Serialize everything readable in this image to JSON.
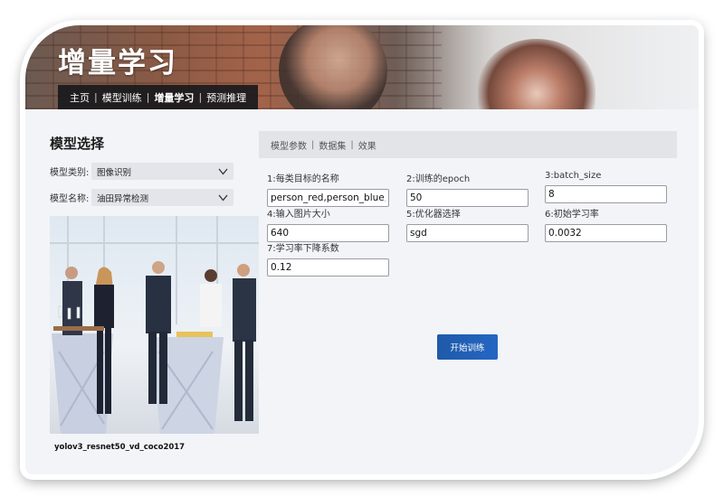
{
  "banner": {
    "title": "增量学习",
    "nav": [
      "主页",
      "模型训练",
      "增量学习",
      "预测推理"
    ],
    "active_index": 2
  },
  "left": {
    "section_title": "模型选择",
    "model_category_label": "模型类别:",
    "model_category_value": "图像识别",
    "model_name_label": "模型名称:",
    "model_name_value": "油田异常检测",
    "image_caption": "yolov3_resnet50_vd_coco2017"
  },
  "right": {
    "tabs": [
      "模型参数",
      "数据集",
      "效果"
    ],
    "fields": [
      {
        "label": "1:每类目标的名称",
        "value": "person_red,person_blue,pers"
      },
      {
        "label": "2:训练的epoch",
        "value": "50"
      },
      {
        "label": "3:batch_size",
        "value": "8"
      },
      {
        "label": "4:输入图片大小",
        "value": "640"
      },
      {
        "label": "5:优化器选择",
        "value": "sgd"
      },
      {
        "label": "6:初始学习率",
        "value": "0.0032"
      },
      {
        "label": "7:学习率下降系数",
        "value": "0.12"
      }
    ],
    "start_button": "开始训练"
  },
  "colors": {
    "accent": "#2566c4",
    "background": "#f3f4f8",
    "navbar": "#19191c"
  },
  "icons": {
    "dropdown": "chevron-down-icon"
  }
}
